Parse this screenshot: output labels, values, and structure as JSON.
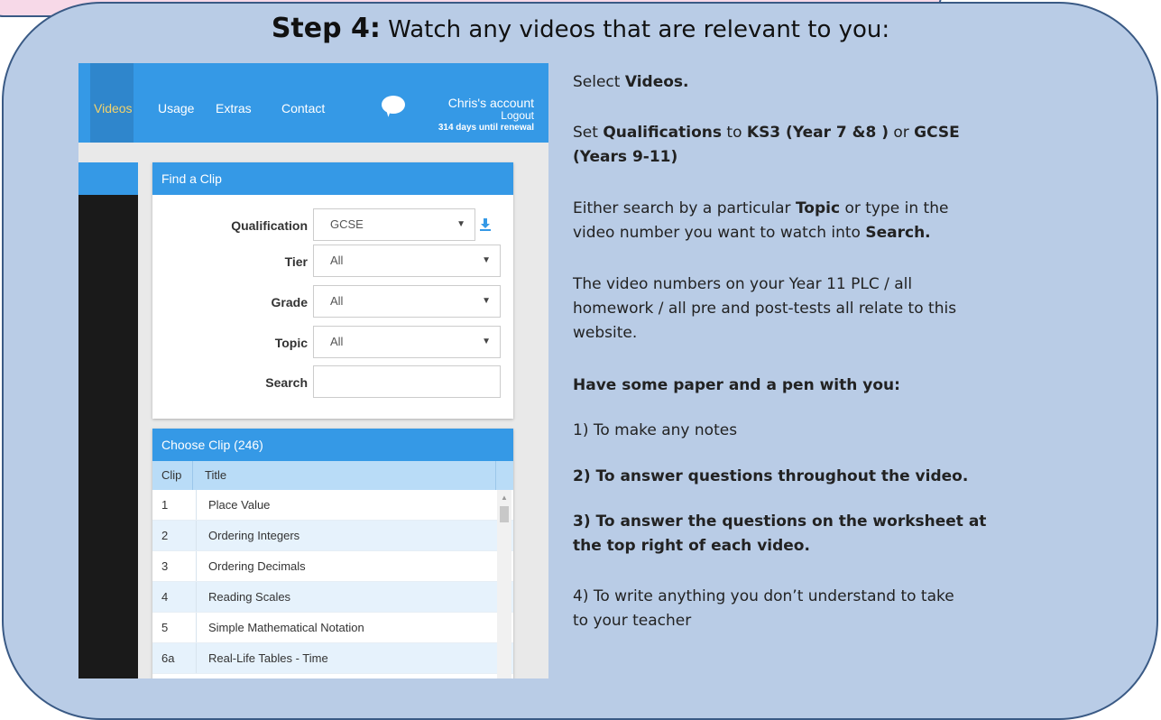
{
  "heading": {
    "step": "Step 4:",
    "text": " Watch any videos that are relevant to you:"
  },
  "screenshot": {
    "nav": [
      "Videos",
      "Usage",
      "Extras",
      "Contact"
    ],
    "account": {
      "name": "Chris's account",
      "logout": "Logout",
      "renewal": "314 days until renewal"
    },
    "find_panel": {
      "title": "Find a Clip",
      "fields": [
        {
          "label": "Qualification",
          "value": "GCSE"
        },
        {
          "label": "Tier",
          "value": "All"
        },
        {
          "label": "Grade",
          "value": "All"
        },
        {
          "label": "Topic",
          "value": "All"
        },
        {
          "label": "Search",
          "value": ""
        }
      ]
    },
    "clips_panel": {
      "title": "Choose Clip (246)",
      "columns": [
        "Clip",
        "Title"
      ],
      "rows": [
        {
          "clip": "1",
          "title": "Place Value"
        },
        {
          "clip": "2",
          "title": "Ordering Integers"
        },
        {
          "clip": "3",
          "title": "Ordering Decimals"
        },
        {
          "clip": "4",
          "title": "Reading Scales"
        },
        {
          "clip": "5",
          "title": "Simple Mathematical Notation"
        },
        {
          "clip": "6a",
          "title": "Real-Life Tables - Time"
        }
      ]
    }
  },
  "instructions": {
    "p1": {
      "a": "Select ",
      "b": "Videos."
    },
    "p2": {
      "a": "Set ",
      "b": "Qualifications",
      "c": " to ",
      "d": "KS3 (Year 7 &8 )",
      "e": " or ",
      "f": "GCSE",
      "g": "(Years 9-11)"
    },
    "p3": {
      "l1a": "Either search by a particular ",
      "l1b": "Topic",
      "l1c": " or type in the",
      "l2a": "video number you want to watch into ",
      "l2b": "Search."
    },
    "p4": {
      "l1": "The video numbers on your Year 11 PLC / all",
      "l2": "homework / all pre and post-tests all relate to this",
      "l3": "website."
    },
    "p5": "Have some paper and a pen with you:",
    "p6": "1) To make any notes",
    "p7": "2) To answer questions throughout the video.",
    "p8": {
      "l1": "3) To answer the questions on the worksheet at",
      "l2": "the top right of each video."
    },
    "p9": {
      "l1": "4) To write anything you don’t understand to take",
      "l2": "to your teacher"
    }
  }
}
